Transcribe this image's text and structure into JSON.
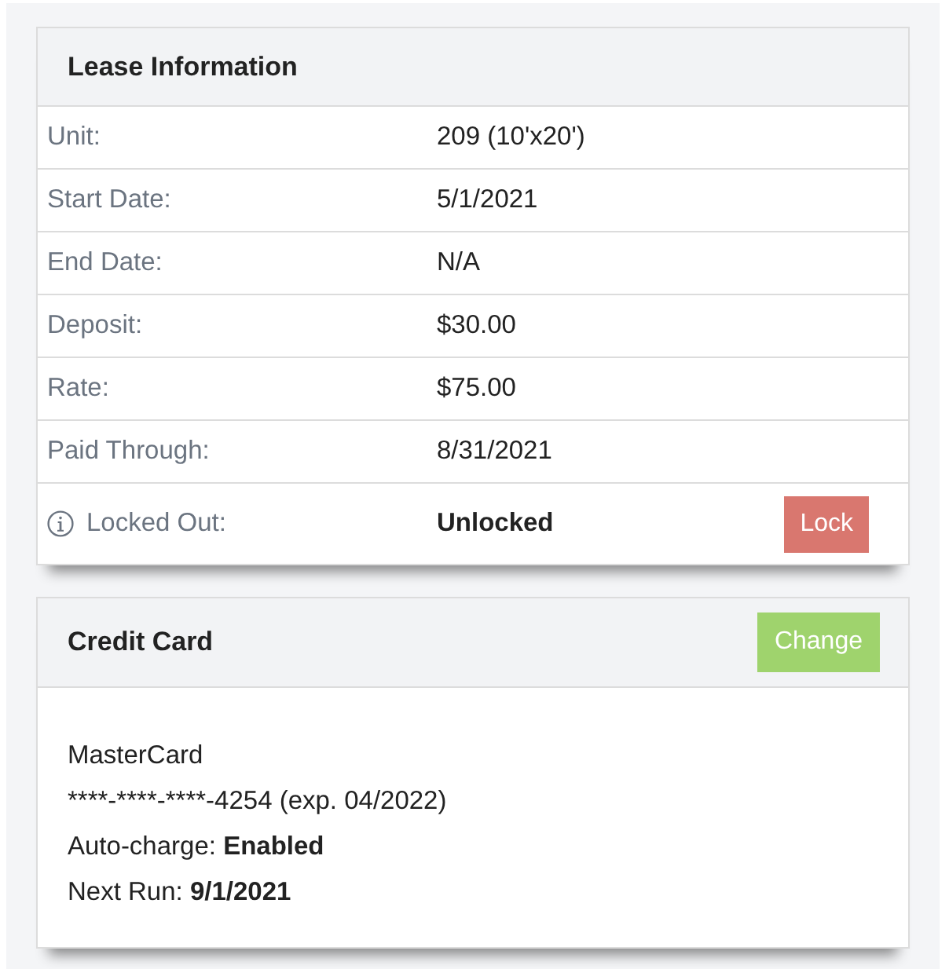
{
  "lease": {
    "title": "Lease Information",
    "rows": [
      {
        "kind": "field",
        "label": "Unit:",
        "value": "209 (10'x20')"
      },
      {
        "kind": "field",
        "label": "Start Date:",
        "value": "5/1/2021"
      },
      {
        "kind": "field",
        "label": "End Date:",
        "value": "N/A"
      },
      {
        "kind": "field",
        "label": "Deposit:",
        "value": "$30.00"
      },
      {
        "kind": "field",
        "label": "Rate:",
        "value": "$75.00"
      },
      {
        "kind": "field",
        "label": "Paid Through:",
        "value": "8/31/2021"
      },
      {
        "kind": "action",
        "label": "Locked Out:",
        "value": "Unlocked",
        "button": "Lock"
      }
    ]
  },
  "credit_card": {
    "title": "Credit Card",
    "button": "Change",
    "lines": [
      {
        "kind": "plain",
        "text": "MasterCard"
      },
      {
        "kind": "plain",
        "text": "****-****-****-4254 (exp. 04/2022)"
      },
      {
        "kind": "pair",
        "label": "Auto-charge:",
        "value": "Enabled"
      },
      {
        "kind": "pair",
        "label": "Next Run:",
        "value": "9/1/2021"
      }
    ]
  }
}
